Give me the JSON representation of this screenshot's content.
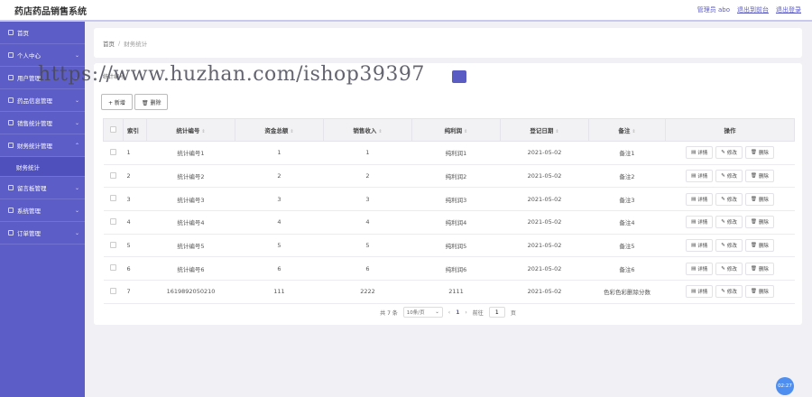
{
  "header": {
    "title": "药店药品销售系统",
    "user_label": "管理员 abo",
    "back_label": "退出到前台",
    "logout_label": "退出登录"
  },
  "sidebar": {
    "items": [
      {
        "label": "首页",
        "icon": "home-icon",
        "chevron": ""
      },
      {
        "label": "个人中心",
        "icon": "user-icon",
        "chevron": "⌄"
      },
      {
        "label": "用户管理",
        "icon": "users-icon",
        "chevron": "⌄"
      },
      {
        "label": "药品信息管理",
        "icon": "pill-icon",
        "chevron": "⌄"
      },
      {
        "label": "销售统计管理",
        "icon": "chart-icon",
        "chevron": "⌄"
      },
      {
        "label": "财务统计管理",
        "icon": "finance-icon",
        "chevron": "⌃"
      }
    ],
    "sub_item": "财务统计",
    "items_after": [
      {
        "label": "留言板管理",
        "icon": "message-icon",
        "chevron": "⌄"
      },
      {
        "label": "系统管理",
        "icon": "settings-icon",
        "chevron": "⌄"
      },
      {
        "label": "订单管理",
        "icon": "order-icon",
        "chevron": "⌄"
      }
    ]
  },
  "breadcrumb": {
    "home": "首页",
    "sep": "/",
    "current": "财务统计"
  },
  "search": {
    "label": "统计编号"
  },
  "watermark": "https://www.huzhan.com/ishop39397",
  "toolbar": {
    "add_label": "+ 新增",
    "delete_label": "🗑 删除"
  },
  "table": {
    "columns": [
      "索引",
      "统计编号",
      "资金总额",
      "销售收入",
      "纯利润",
      "登记日期",
      "备注",
      "操作"
    ],
    "rows": [
      {
        "idx": "1",
        "code": "统计编号1",
        "total": "1",
        "income": "1",
        "profit": "纯利润1",
        "date": "2021-05-02",
        "note": "备注1"
      },
      {
        "idx": "2",
        "code": "统计编号2",
        "total": "2",
        "income": "2",
        "profit": "纯利润2",
        "date": "2021-05-02",
        "note": "备注2"
      },
      {
        "idx": "3",
        "code": "统计编号3",
        "total": "3",
        "income": "3",
        "profit": "纯利润3",
        "date": "2021-05-02",
        "note": "备注3"
      },
      {
        "idx": "4",
        "code": "统计编号4",
        "total": "4",
        "income": "4",
        "profit": "纯利润4",
        "date": "2021-05-02",
        "note": "备注4"
      },
      {
        "idx": "5",
        "code": "统计编号5",
        "total": "5",
        "income": "5",
        "profit": "纯利润5",
        "date": "2021-05-02",
        "note": "备注5"
      },
      {
        "idx": "6",
        "code": "统计编号6",
        "total": "6",
        "income": "6",
        "profit": "纯利润6",
        "date": "2021-05-02",
        "note": "备注6"
      },
      {
        "idx": "7",
        "code": "1619892050210",
        "total": "111",
        "income": "2222",
        "profit": "2111",
        "date": "2021-05-02",
        "note": "色彩色彩删除分数"
      }
    ],
    "ops": {
      "detail": "详情",
      "edit": "修改",
      "delete": "删除"
    }
  },
  "pager": {
    "total": "共 7 条",
    "page_size": "10条/页",
    "current": "1",
    "goto": "前往",
    "goto_value": "1",
    "page_unit": "页"
  },
  "clock": "02:27",
  "colors": {
    "accent": "#5d5dc8",
    "clock": "#4d8ef0"
  }
}
